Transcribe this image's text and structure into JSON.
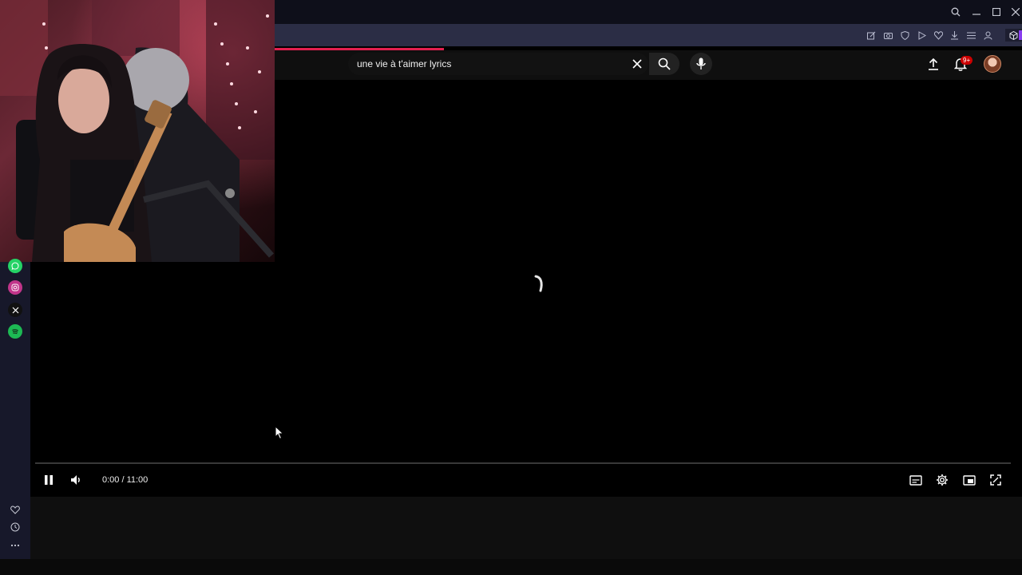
{
  "search": {
    "query": "une vie à t'aimer lyrics"
  },
  "header": {
    "notification_count": "9+"
  },
  "player": {
    "time_display": "0:00 / 11:00",
    "state": "loading",
    "progress_fraction": 0.0
  },
  "icons": {
    "titlebar": [
      "search-icon",
      "minimize-icon",
      "maximize-icon",
      "close-icon"
    ],
    "browser_toolbar": [
      "edit-icon",
      "camera-icon",
      "shield-icon",
      "play-icon",
      "heart-icon",
      "download-icon",
      "menu-icon",
      "profile-icon",
      "cube-icon"
    ],
    "sidebar_apps": [
      "whatsapp-icon",
      "instagram-icon",
      "x-icon",
      "spotify-icon"
    ],
    "sidebar_bottom": [
      "heart-icon",
      "history-icon",
      "more-icon"
    ],
    "player_controls": [
      "pause-icon",
      "volume-icon",
      "subtitles-icon",
      "settings-icon",
      "theater-mode-icon",
      "fullscreen-icon"
    ]
  },
  "colors": {
    "brand_accent": "#e21f4f",
    "notification_badge": "#cc0000",
    "spotify": "#1db954",
    "whatsapp": "#25d366",
    "instagram": "#c1358a"
  }
}
